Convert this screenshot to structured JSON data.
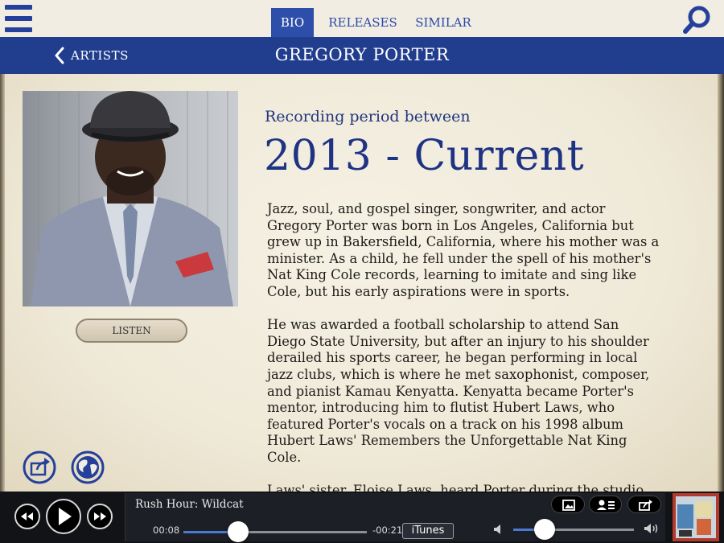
{
  "nav": {
    "tabs": [
      {
        "label": "BIO",
        "active": true
      },
      {
        "label": "RELEASES",
        "active": false
      },
      {
        "label": "SIMILAR",
        "active": false
      }
    ],
    "back_label": "ARTISTS",
    "menu_icon": "hamburger-menu-icon",
    "search_icon": "search-icon"
  },
  "page": {
    "title": "GREGORY PORTER"
  },
  "artist": {
    "listen_label": "LISTEN",
    "period_label": "Recording period between",
    "period_value": "2013 - Current",
    "bio": [
      "Jazz, soul, and gospel singer, songwriter, and actor Gregory Porter was born in Los Angeles, California but grew up in Bakersfield, California, where his mother was a minister. As a child, he fell under the spell of his mother's Nat King Cole records, learning to imitate and sing like Cole, but his early aspirations were in sports.",
      "He was awarded a football scholarship to attend San Diego State University, but after an injury to his shoulder derailed his sports career, he began performing in local jazz clubs, which is where he met saxophonist, composer, and pianist Kamau Kenyatta. Kenyatta became Porter's mentor, introducing him to flutist Hubert Laws, who featured Porter's vocals on a track on his 1998 album Hubert Laws' Remembers the Unforgettable Nat King Cole.",
      "Laws' sister, Eloise Laws, heard Porter during the studio sessions and was impressed with his singing; he helped him get"
    ]
  },
  "player": {
    "track_title": "Rush Hour: Wildcat",
    "elapsed": "00:08",
    "remaining": "-00:21",
    "progress": 0.3,
    "volume": 0.26,
    "itunes_label": "iTunes"
  },
  "colors": {
    "brand_blue": "#213d8e",
    "accent_blue": "#2d4ea9",
    "title_text": "#1f3384",
    "parchment": "#f1ede2"
  }
}
